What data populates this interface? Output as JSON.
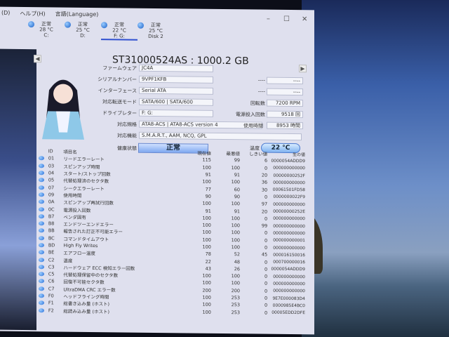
{
  "menu": [
    "(D)",
    "ヘルプ(H)",
    "言語(Language)"
  ],
  "window_controls": {
    "minimize": "–",
    "maximize": "☐",
    "close": "✕"
  },
  "disks": [
    {
      "status": "正常",
      "temp": "28 °C",
      "name": "C:"
    },
    {
      "status": "正常",
      "temp": "25 °C",
      "name": "D:"
    },
    {
      "status": "正常",
      "temp": "22 °C",
      "name": "F: G:"
    },
    {
      "status": "正常",
      "temp": "25 °C",
      "name": "Disk 2"
    }
  ],
  "nav": {
    "prev": "◀",
    "next": "▶"
  },
  "model": "ST31000524AS : 1000.2 GB",
  "info": {
    "firmware_label": "ファームウェア",
    "firmware": "JC4A",
    "serial_label": "シリアルナンバー",
    "serial": "9VPF1KFB",
    "interface_label": "インターフェース",
    "interface": "Serial ATA",
    "transfer_label": "対応転送モード",
    "transfer": "SATA/600 | SATA/600",
    "drive_label": "ドライブレター",
    "drive": "F: G:",
    "standard_label": "対応規格",
    "standard": "ATA8-ACS | ATA8-ACS version 4",
    "features_label": "対応機能",
    "features": "S.M.A.R.T., AAM, NCQ, GPL",
    "health_label": "健康状態",
    "health": "正常",
    "blank1_label": "----",
    "blank1": "----",
    "blank2_label": "----",
    "blank2": "----",
    "rpm_label": "回転数",
    "rpm": "7200 RPM",
    "power_count_label": "電源投入回数",
    "power_count": "9518 回",
    "hours_label": "使用時間",
    "hours": "8953 時間",
    "temp_label": "温度",
    "temp": "22 °C"
  },
  "table": {
    "headers": {
      "id": "ID",
      "name": "項目名",
      "current": "現在値",
      "worst": "最悪値",
      "threshold": "しきい値",
      "raw": "生の値"
    },
    "rows": [
      {
        "id": "01",
        "name": "リードエラーレート",
        "cur": "115",
        "worst": "99",
        "thr": "6",
        "raw": "0000054ADDD9"
      },
      {
        "id": "03",
        "name": "スピンアップ時間",
        "cur": "100",
        "worst": "100",
        "thr": "0",
        "raw": "000000000000"
      },
      {
        "id": "04",
        "name": "スタート/ストップ回数",
        "cur": "91",
        "worst": "91",
        "thr": "20",
        "raw": "00000000252F"
      },
      {
        "id": "05",
        "name": "代替処理済のセクタ数",
        "cur": "100",
        "worst": "100",
        "thr": "36",
        "raw": "000000000000"
      },
      {
        "id": "07",
        "name": "シークエラーレート",
        "cur": "77",
        "worst": "60",
        "thr": "30",
        "raw": "00061501FD58"
      },
      {
        "id": "09",
        "name": "使用時間",
        "cur": "90",
        "worst": "90",
        "thr": "0",
        "raw": "0000000022F9"
      },
      {
        "id": "0A",
        "name": "スピンアップ再試行回数",
        "cur": "100",
        "worst": "100",
        "thr": "97",
        "raw": "000000000000"
      },
      {
        "id": "0C",
        "name": "電源投入回数",
        "cur": "91",
        "worst": "91",
        "thr": "20",
        "raw": "00000000252E"
      },
      {
        "id": "B7",
        "name": "ベンダ固有",
        "cur": "100",
        "worst": "100",
        "thr": "0",
        "raw": "000000000000"
      },
      {
        "id": "B8",
        "name": "エンドツーエンドエラー",
        "cur": "100",
        "worst": "100",
        "thr": "99",
        "raw": "000000000000"
      },
      {
        "id": "BB",
        "name": "報告された訂正不可能エラー",
        "cur": "100",
        "worst": "100",
        "thr": "0",
        "raw": "000000000000"
      },
      {
        "id": "BC",
        "name": "コマンドタイムアウト",
        "cur": "100",
        "worst": "100",
        "thr": "0",
        "raw": "000000000001"
      },
      {
        "id": "BD",
        "name": "High Fly Writes",
        "cur": "100",
        "worst": "100",
        "thr": "0",
        "raw": "000000000000"
      },
      {
        "id": "BE",
        "name": "エアフロー温度",
        "cur": "78",
        "worst": "52",
        "thr": "45",
        "raw": "000016150016"
      },
      {
        "id": "C2",
        "name": "温度",
        "cur": "22",
        "worst": "48",
        "thr": "0",
        "raw": "000700000016"
      },
      {
        "id": "C3",
        "name": "ハードウェア ECC 検知エラー回数",
        "cur": "43",
        "worst": "26",
        "thr": "0",
        "raw": "0000054ADDD9"
      },
      {
        "id": "C5",
        "name": "代替処理保留中のセクタ数",
        "cur": "100",
        "worst": "100",
        "thr": "0",
        "raw": "000000000000"
      },
      {
        "id": "C6",
        "name": "回復不可能セクタ数",
        "cur": "100",
        "worst": "100",
        "thr": "0",
        "raw": "000000000000"
      },
      {
        "id": "C7",
        "name": "UltraDMA CRC エラー数",
        "cur": "200",
        "worst": "200",
        "thr": "0",
        "raw": "000000000000"
      },
      {
        "id": "F0",
        "name": "ヘッドフライング時間",
        "cur": "100",
        "worst": "253",
        "thr": "0",
        "raw": "9E7E000083D4"
      },
      {
        "id": "F1",
        "name": "総書き込み量 (ホスト)",
        "cur": "100",
        "worst": "253",
        "thr": "0",
        "raw": "0000985E4BC0"
      },
      {
        "id": "F2",
        "name": "総読み込み量 (ホスト)",
        "cur": "100",
        "worst": "253",
        "thr": "0",
        "raw": "00005EDD2DFE"
      }
    ]
  }
}
